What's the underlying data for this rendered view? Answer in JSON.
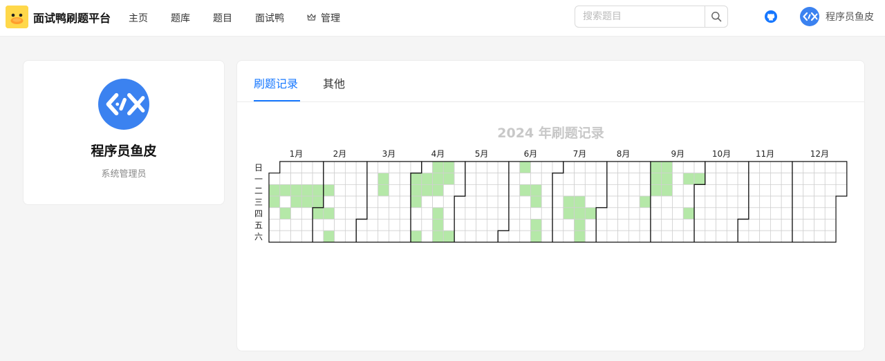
{
  "header": {
    "logo_icon": "duck-logo-icon",
    "app_title": "面试鸭刷题平台",
    "nav": [
      {
        "label": "主页"
      },
      {
        "label": "题库"
      },
      {
        "label": "题目"
      },
      {
        "label": "面试鸭"
      },
      {
        "label": "管理",
        "icon": "crown-icon"
      }
    ],
    "search": {
      "placeholder": "搜索题目",
      "value": ""
    },
    "user_name": "程序员鱼皮"
  },
  "profile": {
    "name": "程序员鱼皮",
    "role": "系统管理员"
  },
  "tabs": [
    {
      "label": "刷题记录",
      "active": true
    },
    {
      "label": "其他",
      "active": false
    }
  ],
  "heatmap": {
    "title": "2024 年刷题记录",
    "year": 2024,
    "weekday_labels": [
      "日",
      "一",
      "二",
      "三",
      "四",
      "五",
      "六"
    ],
    "month_labels": [
      "1月",
      "2月",
      "3月",
      "4月",
      "5月",
      "6月",
      "7月",
      "8月",
      "9月",
      "10月",
      "11月",
      "12月"
    ],
    "active_color": "#b5e8a8",
    "border_color": "#111111",
    "grid_color": "#d0d0d0",
    "active_days": [
      "2024-01-02",
      "2024-01-03",
      "2024-01-09",
      "2024-01-11",
      "2024-01-16",
      "2024-01-17",
      "2024-01-23",
      "2024-01-24",
      "2024-01-30",
      "2024-01-31",
      "2024-02-01",
      "2024-02-06",
      "2024-02-08",
      "2024-02-10",
      "2024-03-11",
      "2024-03-12",
      "2024-04-01",
      "2024-04-02",
      "2024-04-03",
      "2024-04-06",
      "2024-04-08",
      "2024-04-09",
      "2024-04-14",
      "2024-04-15",
      "2024-04-16",
      "2024-04-18",
      "2024-04-19",
      "2024-04-20",
      "2024-04-21",
      "2024-04-22",
      "2024-04-27",
      "2024-06-09",
      "2024-06-11",
      "2024-06-18",
      "2024-06-19",
      "2024-06-21",
      "2024-06-22",
      "2024-07-10",
      "2024-07-11",
      "2024-07-17",
      "2024-07-18",
      "2024-07-19",
      "2024-07-20",
      "2024-07-25",
      "2024-08-28",
      "2024-09-01",
      "2024-09-02",
      "2024-09-03",
      "2024-09-08",
      "2024-09-09",
      "2024-09-10",
      "2024-09-23",
      "2024-09-26",
      "2024-09-30"
    ]
  }
}
